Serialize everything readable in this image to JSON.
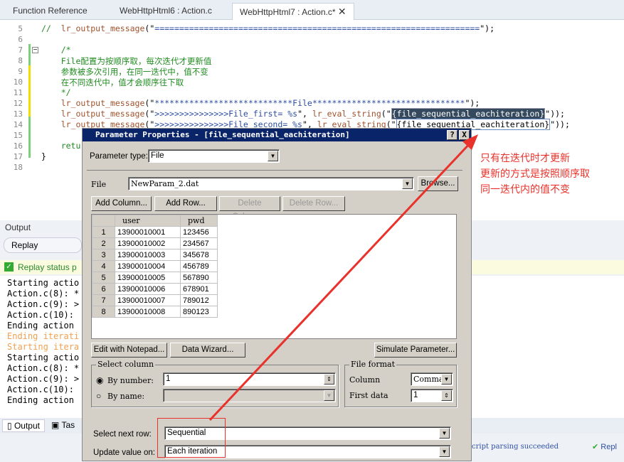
{
  "tabs": [
    {
      "label": "Function Reference"
    },
    {
      "label": "WebHttpHtml6 : Action.c"
    },
    {
      "label": "WebHttpHtml7 : Action.c*"
    }
  ],
  "code": {
    "lines": [
      {
        "n": "5",
        "parts": [
          [
            "cm",
            "//  "
          ],
          [
            "fn",
            "lr_output_message"
          ],
          [
            "",
            "(\""
          ],
          [
            "str",
            "=================================================================="
          ],
          [
            "",
            "\");"
          ]
        ]
      },
      {
        "n": "6",
        "parts": []
      },
      {
        "n": "7",
        "parts": [
          [
            "cm",
            "    /*"
          ]
        ]
      },
      {
        "n": "8",
        "parts": [
          [
            "cm",
            "    File配置为按顺序取，每次迭代才更新值"
          ]
        ]
      },
      {
        "n": "9",
        "parts": [
          [
            "cm",
            "    参数被多次引用，在同一迭代中，值不变"
          ]
        ]
      },
      {
        "n": "10",
        "parts": [
          [
            "cm",
            "    在不同迭代中，值才会顺序往下取"
          ]
        ]
      },
      {
        "n": "11",
        "parts": [
          [
            "cm",
            "    */"
          ]
        ]
      },
      {
        "n": "12",
        "parts": [
          [
            "",
            "    "
          ],
          [
            "fn",
            "lr_output_message"
          ],
          [
            "",
            "(\""
          ],
          [
            "str",
            "****************************File*******************************"
          ],
          [
            "",
            "\");"
          ]
        ]
      },
      {
        "n": "13",
        "parts": [
          [
            "",
            "    "
          ],
          [
            "fn",
            "lr_output_message"
          ],
          [
            "",
            "(\""
          ],
          [
            "str",
            ">>>>>>>>>>>>>>>File_first= %s"
          ],
          [
            "",
            "\", "
          ],
          [
            "fn",
            "lr_eval_string"
          ],
          [
            "",
            "(\""
          ],
          [
            "hl",
            "{file_sequential_eachiteration}"
          ],
          [
            "",
            "\"));"
          ]
        ]
      },
      {
        "n": "14",
        "parts": [
          [
            "",
            "    "
          ],
          [
            "fn",
            "lr_output_message"
          ],
          [
            "",
            "(\""
          ],
          [
            "str",
            ">>>>>>>>>>>>>>>File_second= %s"
          ],
          [
            "",
            "\", "
          ],
          [
            "fn",
            "lr_eval_string"
          ],
          [
            "",
            "(\""
          ],
          [
            "bx",
            "{file_sequential_eachiteration}"
          ],
          [
            "",
            "\"));"
          ]
        ]
      },
      {
        "n": "15",
        "parts": []
      },
      {
        "n": "16",
        "parts": [
          [
            "",
            "    "
          ],
          [
            "cm",
            "retu"
          ]
        ]
      },
      {
        "n": "17",
        "parts": [
          [
            "",
            "}"
          ]
        ]
      },
      {
        "n": "18",
        "parts": []
      }
    ]
  },
  "output": {
    "title": "Output",
    "replay_tab": "Replay",
    "status": "Replay status p",
    "log": [
      {
        "t": "Starting actio",
        "c": "#000"
      },
      {
        "t": "Action.c(8): *",
        "c": "#000"
      },
      {
        "t": "Action.c(9): >",
        "c": "#000"
      },
      {
        "t": "Action.c(10): ",
        "c": "#000"
      },
      {
        "t": "Ending action ",
        "c": "#000"
      },
      {
        "t": "Ending iterati",
        "c": "#f0a050"
      },
      {
        "t": "Starting itera",
        "c": "#f0a050"
      },
      {
        "t": "Starting actio",
        "c": "#000"
      },
      {
        "t": "Action.c(8): *",
        "c": "#000"
      },
      {
        "t": "Action.c(9): >",
        "c": "#000"
      },
      {
        "t": "Action.c(10): ",
        "c": "#000"
      },
      {
        "t": "Ending action ",
        "c": "#000"
      }
    ],
    "bottom_tabs": [
      "Output",
      "Tas"
    ],
    "statusbar": {
      "parse": "cript parsing succeeded",
      "replay": "Repl"
    }
  },
  "dialog": {
    "title": "Parameter Properties - [file_sequential_eachiteration]",
    "help": "?",
    "close": "X",
    "param_type_label": "Parameter type:",
    "param_type": "File",
    "file_label": "File",
    "file_value": "NewParam_2.dat",
    "browse": "Browse...",
    "add_column": "Add Column...",
    "add_row": "Add Row...",
    "delete_column": "Delete Column...",
    "delete_row": "Delete Row...",
    "columns": [
      "user",
      "pwd"
    ],
    "rows": [
      [
        "1",
        "13900010001",
        "123456"
      ],
      [
        "2",
        "13900010002",
        "234567"
      ],
      [
        "3",
        "13900010003",
        "345678"
      ],
      [
        "4",
        "13900010004",
        "456789"
      ],
      [
        "5",
        "13900010005",
        "567890"
      ],
      [
        "6",
        "13900010006",
        "678901"
      ],
      [
        "7",
        "13900010007",
        "789012"
      ],
      [
        "8",
        "13900010008",
        "890123"
      ]
    ],
    "edit_notepad": "Edit with Notepad...",
    "data_wizard": "Data Wizard...",
    "simulate": "Simulate Parameter...",
    "select_column": {
      "title": "Select column",
      "by_number": "By number:",
      "number_value": "1",
      "by_name": "By name:",
      "selected": "by_number"
    },
    "file_format": {
      "title": "File format",
      "column_label": "Column",
      "column_value": "Comma",
      "first_data_label": "First data",
      "first_data_value": "1"
    },
    "select_next_row_label": "Select next row:",
    "select_next_row": "Sequential",
    "update_value_label": "Update value on:",
    "update_value": "Each iteration"
  },
  "annotation": {
    "lines": [
      "只有在迭代时才更新",
      "更新的方式是按照顺序取",
      "同一迭代内的值不变"
    ],
    "color": "#e8322b"
  }
}
